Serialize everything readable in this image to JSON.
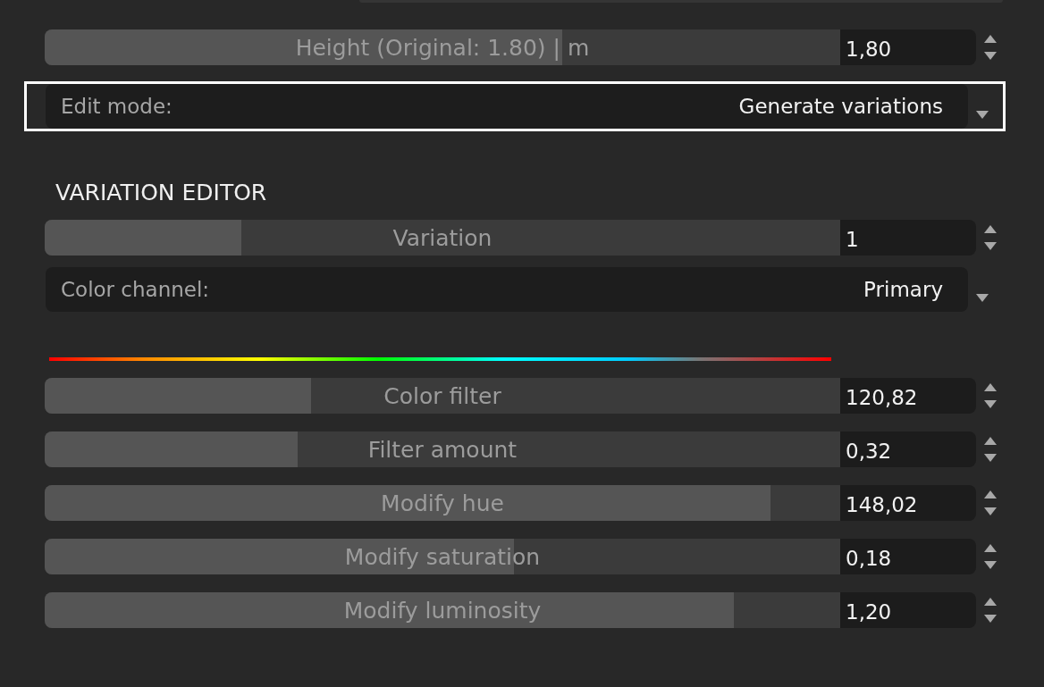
{
  "height_slider": {
    "label": "Height (Original: 1.80) | m",
    "level": 0.65,
    "value": "1,80"
  },
  "edit_mode": {
    "label": "Edit mode:",
    "value": "Generate variations",
    "focused": true
  },
  "variation_editor": {
    "heading": "VARIATION EDITOR",
    "controls": [
      {
        "kind": "slider",
        "label": "Variation",
        "level": 0.247,
        "value": "1"
      },
      {
        "kind": "select",
        "label": "Color channel:",
        "value": "Primary",
        "focused": false
      },
      {
        "kind": "hue_bar"
      },
      {
        "kind": "slider",
        "label": "Color filter",
        "level": 0.335,
        "value": "120,82"
      },
      {
        "kind": "slider",
        "label": "Filter amount",
        "level": 0.318,
        "value": "0,32"
      },
      {
        "kind": "slider",
        "label": "Modify hue",
        "level": 0.912,
        "value": "148,02"
      },
      {
        "kind": "slider",
        "label": "Modify saturation",
        "level": 0.59,
        "value": "0,18"
      },
      {
        "kind": "slider",
        "label": "Modify luminosity",
        "level": 0.866,
        "value": "1,20"
      }
    ]
  }
}
